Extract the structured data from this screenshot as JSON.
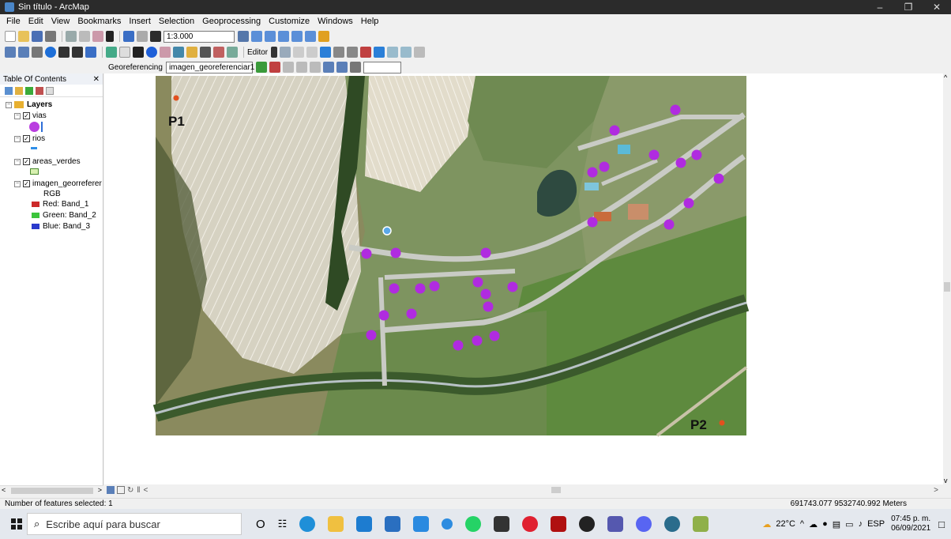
{
  "window": {
    "title": "Sin título - ArcMap"
  },
  "menu": [
    "File",
    "Edit",
    "View",
    "Bookmarks",
    "Insert",
    "Selection",
    "Geoprocessing",
    "Customize",
    "Windows",
    "Help"
  ],
  "toolbar": {
    "scale": "1:3.000",
    "editor_label": "Editor",
    "georef_label": "Georeferencing",
    "georef_layer": "imagen_georeferenciar1"
  },
  "toc": {
    "title": "Table Of Contents",
    "root": "Layers",
    "layers": [
      {
        "name": "vias",
        "symbol": "#b93ee0"
      },
      {
        "name": "rios",
        "symbol": "#2f8fe8"
      },
      {
        "name": "areas_verdes",
        "symbol": "#d8f0b0"
      },
      {
        "name": "imagen_georreferer",
        "sub": "RGB",
        "bands": [
          {
            "label": "Red:   Band_1",
            "color": "#cc2a2a"
          },
          {
            "label": "Green: Band_2",
            "color": "#3cc43c"
          },
          {
            "label": "Blue:  Band_3",
            "color": "#2a3acc"
          }
        ]
      }
    ]
  },
  "map": {
    "p1_label": "P1",
    "p2_label": "P2",
    "point_color": "#a020e0",
    "control_color": "#e2501e"
  },
  "status": {
    "selected": "Number of features selected: 1",
    "coords": "691743.077  9532740.992 Meters"
  },
  "taskbar": {
    "search_placeholder": "Escribe aquí para buscar",
    "weather": "22°C",
    "lang": "ESP",
    "time": "07:45 p. m.",
    "date": "06/09/2021"
  }
}
